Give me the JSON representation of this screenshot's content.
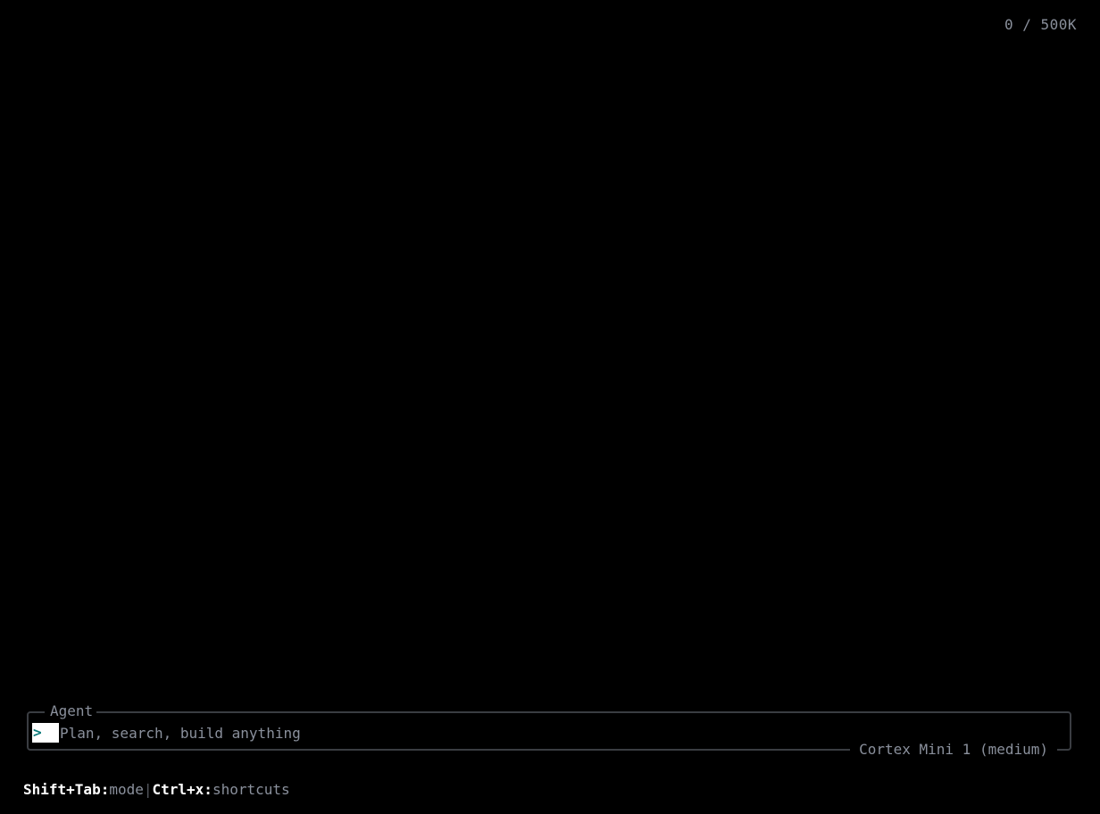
{
  "header": {
    "token_counter": "0 / 500K"
  },
  "input_panel": {
    "mode_label": "Agent",
    "prompt_symbol": ">",
    "placeholder": "Plan, search, build anything",
    "model": "Cortex Mini 1 (medium)"
  },
  "footer": {
    "hints": [
      {
        "key": "Shift+Tab:",
        "action": "mode"
      },
      {
        "key": "Ctrl+x:",
        "action": "shortcuts"
      }
    ],
    "separator": "|"
  }
}
